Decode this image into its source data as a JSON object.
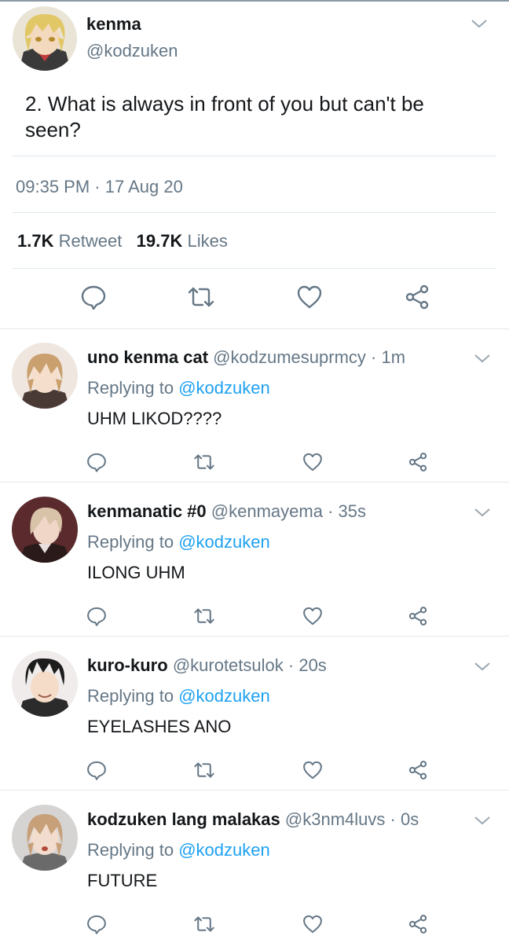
{
  "main_tweet": {
    "name": "kenma",
    "handle": "@kodzuken",
    "text": "2. What is always in front of you but can't be seen?",
    "timestamp": "09:35 PM · 17 Aug 20",
    "retweet_count": "1.7K",
    "retweet_label": "Retweet",
    "like_count": "19.7K",
    "like_label": "Likes",
    "actions": [
      "reply-icon",
      "retweet-icon",
      "like-icon",
      "share-icon"
    ]
  },
  "replies": [
    {
      "name": "uno kenma cat",
      "handle": "@kodzumesuprmcy",
      "time": "· 1m",
      "replying_prefix": "Replying to",
      "replying_to": "@kodzuken",
      "text": "UHM LIKOD????"
    },
    {
      "name": "kenmanatic #0",
      "handle": "@kenmayema",
      "time": "· 35s",
      "replying_prefix": "Replying to",
      "replying_to": "@kodzuken",
      "text": "ILONG UHM"
    },
    {
      "name": "kuro-kuro",
      "handle": "@kurotetsulok",
      "time": "· 20s",
      "replying_prefix": "Replying to",
      "replying_to": "@kodzuken",
      "text": "EYELASHES ANO"
    },
    {
      "name": "kodzuken lang malakas",
      "handle": "@k3nm4luvs",
      "time": "· 0s",
      "replying_prefix": "Replying to",
      "replying_to": "@kodzuken",
      "text": "FUTURE"
    }
  ],
  "colors": {
    "text": "#14171a",
    "secondary": "#657786",
    "link": "#1da1f2",
    "divider": "#e1e8ed"
  }
}
